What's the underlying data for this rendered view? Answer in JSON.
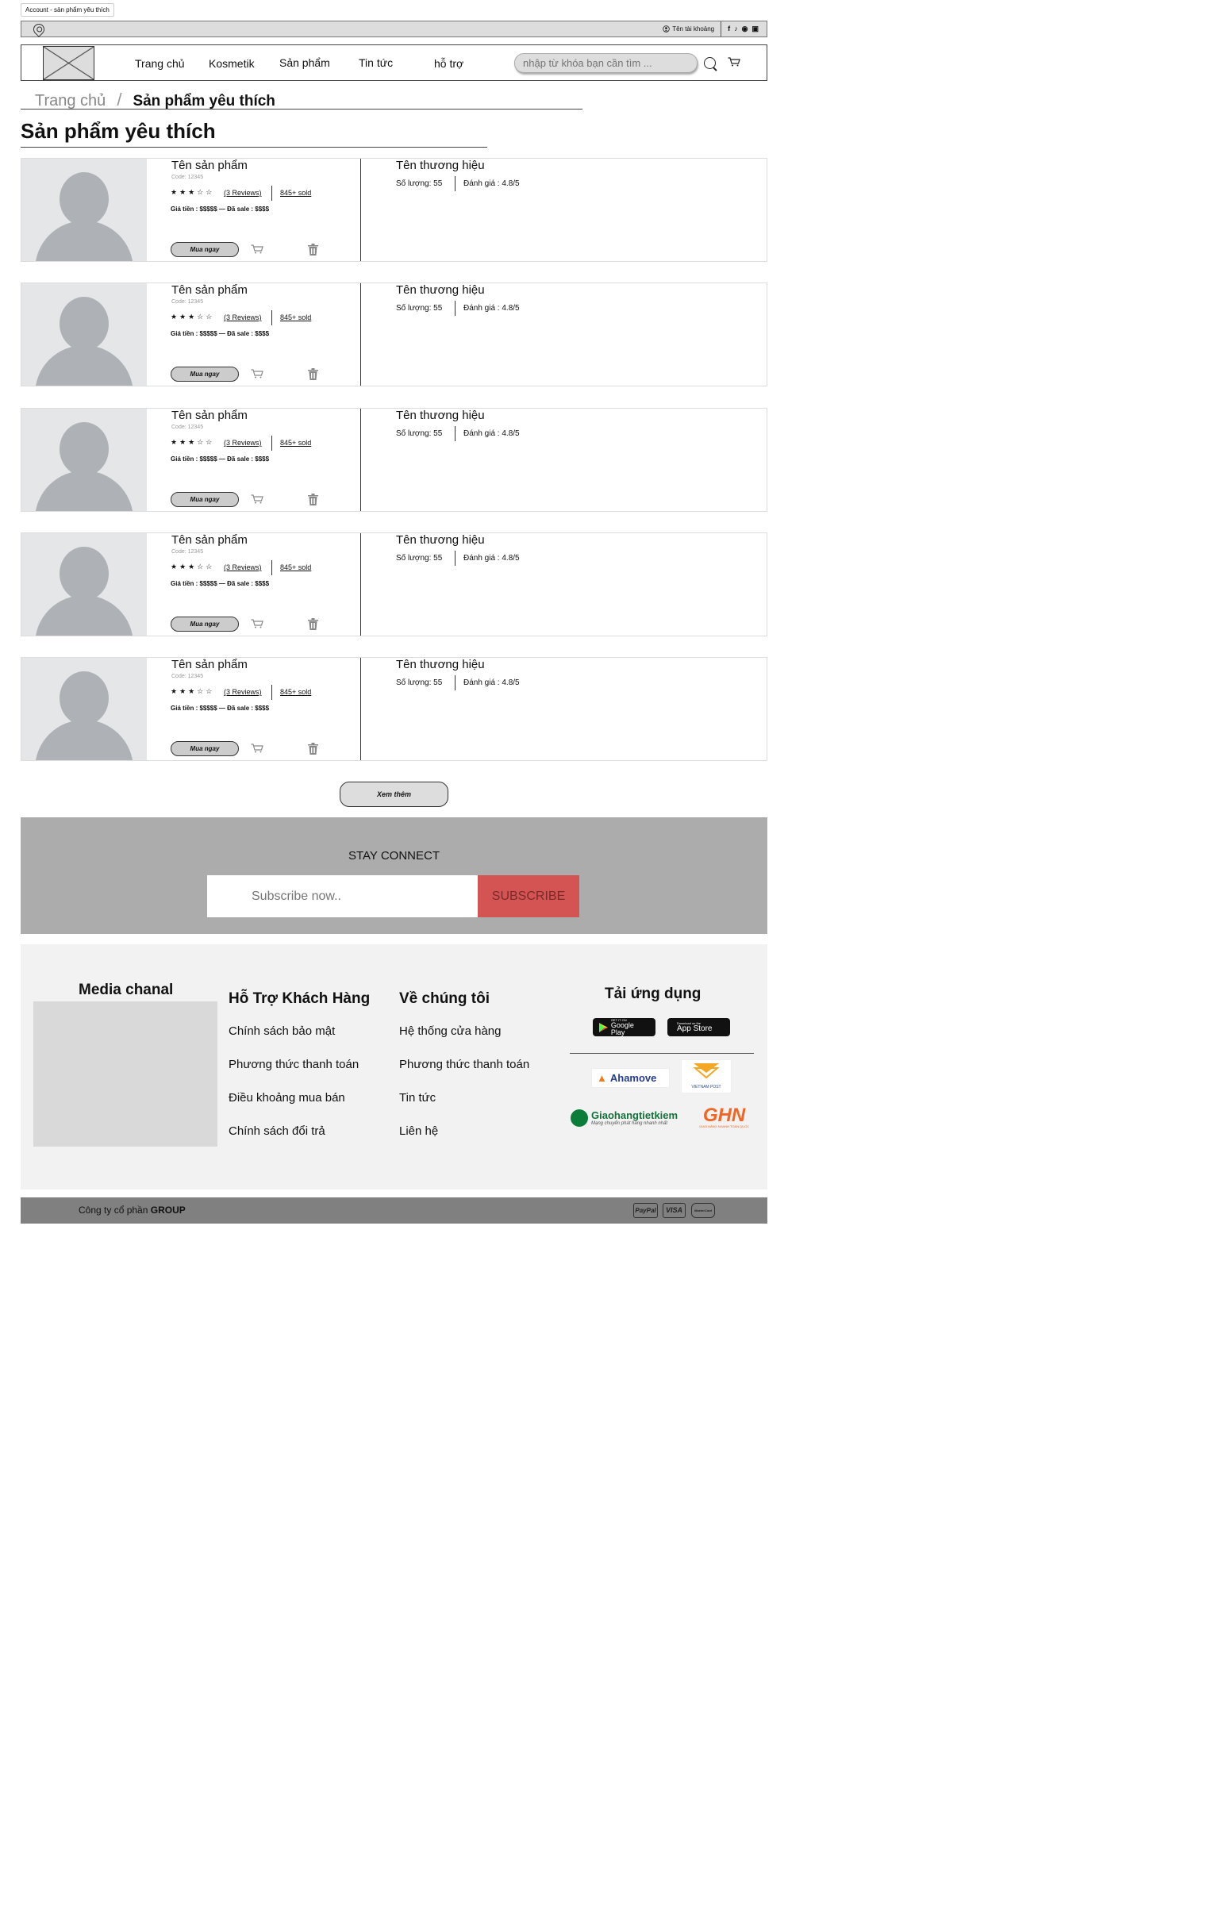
{
  "frame_label": "Account - sản phẩm yêu thích",
  "topbar": {
    "account_label": "Tên tài khoảng",
    "socials": [
      "f",
      "♪",
      "◉",
      "▣"
    ]
  },
  "nav": [
    "Trang chủ",
    "Kosmetik",
    "Sản phẩm",
    "Tin tức",
    "hỗ trợ"
  ],
  "search": {
    "placeholder": "nhập từ khóa bạn cần tìm ..."
  },
  "breadcrumb": {
    "home": "Trang chủ",
    "sep": "/",
    "current": "Sản phẩm yêu thích"
  },
  "page_title": "Sản phẩm yêu thích",
  "products": [
    {
      "name": "Tên sản phẩm",
      "code": "Code: 12345",
      "stars": "★★★☆☆",
      "reviews": "(3 Reviews)",
      "sold": "845+ sold",
      "price": "Giá tiền : $$$$$  —  Đã sale : $$$$",
      "buy": "Mua ngay",
      "brand": "Tên thương hiệu",
      "qty": "Số lượng: 55",
      "rating": "Đánh giá : 4.8/5"
    },
    {
      "name": "Tên sản phẩm",
      "code": "Code: 12345",
      "stars": "★★★☆☆",
      "reviews": "(3 Reviews)",
      "sold": "845+ sold",
      "price": "Giá tiền : $$$$$  —  Đã sale : $$$$",
      "buy": "Mua ngay",
      "brand": "Tên thương hiệu",
      "qty": "Số lượng: 55",
      "rating": "Đánh giá : 4.8/5"
    },
    {
      "name": "Tên sản phẩm",
      "code": "Code: 12345",
      "stars": "★★★☆☆",
      "reviews": "(3 Reviews)",
      "sold": "845+ sold",
      "price": "Giá tiền : $$$$$  —  Đã sale : $$$$",
      "buy": "Mua ngay",
      "brand": "Tên thương hiệu",
      "qty": "Số lượng: 55",
      "rating": "Đánh giá : 4.8/5"
    },
    {
      "name": "Tên sản phẩm",
      "code": "Code: 12345",
      "stars": "★★★☆☆",
      "reviews": "(3 Reviews)",
      "sold": "845+ sold",
      "price": "Giá tiền : $$$$$  —  Đã sale : $$$$",
      "buy": "Mua ngay",
      "brand": "Tên thương hiệu",
      "qty": "Số lượng: 55",
      "rating": "Đánh giá : 4.8/5"
    },
    {
      "name": "Tên sản phẩm",
      "code": "Code: 12345",
      "stars": "★★★☆☆",
      "reviews": "(3 Reviews)",
      "sold": "845+ sold",
      "price": "Giá tiền : $$$$$  —  Đã sale : $$$$",
      "buy": "Mua ngay",
      "brand": "Tên thương hiệu",
      "qty": "Số lượng: 55",
      "rating": "Đánh giá : 4.8/5"
    }
  ],
  "more_button": "Xem thêm",
  "stay": {
    "title": "STAY CONNECT",
    "placeholder": "Subscribe now..",
    "button": "SUBSCRIBE"
  },
  "footer": {
    "media_title": "Media chanal",
    "support": {
      "title": "Hỗ Trợ Khách Hàng",
      "links": [
        "Chính sách bảo mật",
        "Phương thức thanh toán",
        "Điều khoảng mua bán",
        "Chính sách đổi trả"
      ]
    },
    "about": {
      "title": "Về chúng tôi",
      "links": [
        "Hệ thống cửa hàng",
        "Phương thức thanh toán",
        "Tin tức",
        "Liên hệ"
      ]
    },
    "app": {
      "title": "Tải ứng dụng",
      "google_small": "GET IT ON",
      "google": "Google Play",
      "apple_small": "Download on the",
      "apple": "App Store"
    },
    "shipping": {
      "ahamove": "Ahamove",
      "vnpost": "VIETNAM POST",
      "ghtk": "Giaohangtietkiem",
      "ghtk_sub": "Mạng chuyển phát hàng nhanh nhất",
      "ghn": "GHN",
      "ghn_sub": "GIAO HÀNG NHANH TOÀN QUỐC"
    }
  },
  "bottom": {
    "company_prefix": "Công ty cổ phần ",
    "company_bold": "GROUP",
    "payments": [
      "PayPal",
      "VISA",
      "MasterCard"
    ]
  }
}
